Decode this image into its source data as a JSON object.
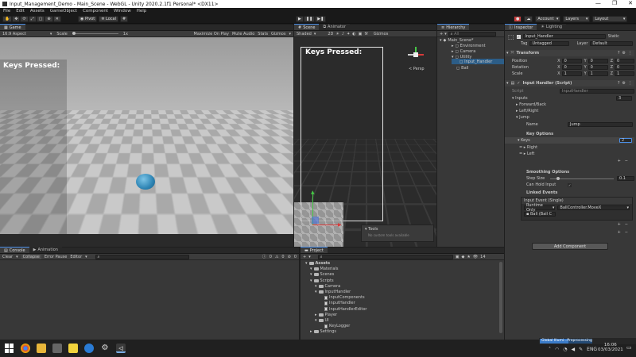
{
  "window": {
    "title": "Input_Management_Demo - Main_Scene - WebGL - Unity 2020.2.1f1 Personal* <DX11>",
    "controls": [
      "—",
      "❐",
      "✕"
    ]
  },
  "menu": [
    "File",
    "Edit",
    "Assets",
    "GameObject",
    "Component",
    "Window",
    "Help"
  ],
  "toolbar": {
    "pivot": "Pivot",
    "local": "Local",
    "account": "Account",
    "layers": "Layers",
    "layout": "Layout"
  },
  "game": {
    "tab": "Game",
    "aspect": "16:9 Aspect",
    "scale_label": "Scale",
    "scale_value": "1x",
    "maximize": "Maximize On Play",
    "mute": "Mute Audio",
    "stats": "Stats",
    "gizmos": "Gizmos",
    "overlay_text": "Keys Pressed:"
  },
  "scene": {
    "tabs": [
      "Scene",
      "Animator"
    ],
    "shading": "Shaded",
    "mode": "2D",
    "gizmos": "Gizmos",
    "overlay_text": "Keys Pressed:",
    "persp": "< Persp",
    "tools_title": "Tools",
    "tools_msg": "No custom tools available"
  },
  "hierarchy": {
    "tab": "Hierarchy",
    "add": "+",
    "search_placeholder": "All",
    "scene": "Main_Scene*",
    "items": [
      "Environment",
      "Camera",
      "Utility",
      "Input_Handler",
      "Ball"
    ]
  },
  "inspector": {
    "tabs": [
      "Inspector",
      "Lighting"
    ],
    "object_name": "Input_Handler",
    "static": "Static",
    "tag_label": "Tag",
    "tag_value": "Untagged",
    "layer_label": "Layer",
    "layer_value": "Default",
    "transform": {
      "title": "Transform",
      "rows": [
        {
          "label": "Position",
          "x": "0",
          "y": "0",
          "z": "0"
        },
        {
          "label": "Rotation",
          "x": "0",
          "y": "0",
          "z": "0"
        },
        {
          "label": "Scale",
          "x": "1",
          "y": "1",
          "z": "1"
        }
      ]
    },
    "script_comp": {
      "title": "Input Handler (Script)",
      "script_label": "Script",
      "script_value": "InputHandler",
      "inputs_label": "Inputs",
      "inputs_count": "3",
      "items": [
        "Forward/Back",
        "Left/Right",
        "Jump"
      ],
      "name_label": "Name",
      "name_value": "Jump",
      "key_options": "Key Options",
      "keys_label": "Keys",
      "keys_count": "2",
      "keys": [
        "Right",
        "Left"
      ],
      "smoothing": "Smoothing Options",
      "step_label": "Step Size",
      "step_value": "0.1",
      "step_fraction": 0.1,
      "hold_label": "Can Hold Input",
      "linked": "Linked Events",
      "event_title": "Input Event (Single)",
      "runtime": "Runtime Only",
      "method": "BallController.MoveX",
      "target": "Ball (Ball C"
    },
    "add_component": "Add Component"
  },
  "console": {
    "tabs": [
      "Console",
      "Animation"
    ],
    "buttons": [
      "Clear",
      "Collapse",
      "Error Pause",
      "Editor"
    ],
    "counts": [
      "0",
      "0",
      "0"
    ]
  },
  "project": {
    "tab": "Project",
    "count": "14",
    "tree": [
      {
        "label": "Assets",
        "depth": 0,
        "type": "folder"
      },
      {
        "label": "Materials",
        "depth": 1,
        "type": "folder"
      },
      {
        "label": "Scenes",
        "depth": 1,
        "type": "folder"
      },
      {
        "label": "Scripts",
        "depth": 1,
        "type": "folder"
      },
      {
        "label": "Camera",
        "depth": 2,
        "type": "folder"
      },
      {
        "label": "InputHandler",
        "depth": 2,
        "type": "folder"
      },
      {
        "label": "InputComponents",
        "depth": 3,
        "type": "script"
      },
      {
        "label": "InputHandler",
        "depth": 3,
        "type": "script"
      },
      {
        "label": "InputHandlerEditor",
        "depth": 3,
        "type": "script"
      },
      {
        "label": "Player",
        "depth": 2,
        "type": "folder"
      },
      {
        "label": "UI",
        "depth": 2,
        "type": "folder"
      },
      {
        "label": "KeyLogger",
        "depth": 3,
        "type": "script"
      },
      {
        "label": "Settings",
        "depth": 1,
        "type": "folder"
      }
    ]
  },
  "status": {
    "progress_text": "Global Illumi...Preprocessing",
    "progress": 0.55
  },
  "taskbar": {
    "lang": "ENG",
    "time": "16:06",
    "date": "03/03/2021"
  },
  "colors": {
    "accent": "#4a8ee6",
    "selection": "#2c5d87",
    "toggle": "#2e6fbf"
  }
}
